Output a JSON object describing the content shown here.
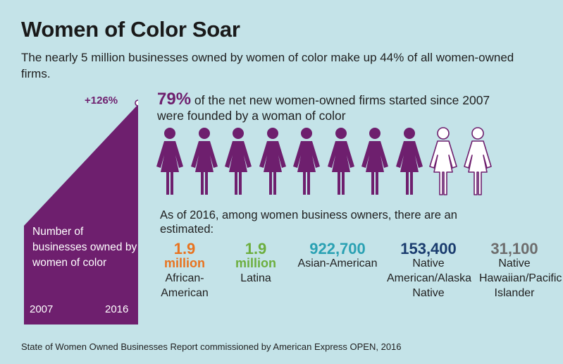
{
  "title": "Women of Color Soar",
  "subtitle": "The nearly 5 million businesses owned by women of color make up 44% of all women-owned firms.",
  "growth": {
    "label": "+126%",
    "value_percent": 126,
    "caption": "Number of businesses owned by women of color",
    "year_start": "2007",
    "year_end": "2016",
    "color": "#6e1f6e"
  },
  "headline": {
    "percent": "79%",
    "text": " of the net new women-owned firms started since 2007 were founded by a woman of color"
  },
  "pictogram": {
    "filled": 8,
    "total": 10,
    "filled_color": "#6e1f6e",
    "empty_color": "#ffffff"
  },
  "breakdown": {
    "intro": "As of 2016, among women business owners, there are an estimated:",
    "items": [
      {
        "number": "1.9",
        "unit": "million",
        "label": "African-American",
        "color": "#e8731f"
      },
      {
        "number": "1.9",
        "unit": "million",
        "label": "Latina",
        "color": "#6cae3e"
      },
      {
        "number": "922,700",
        "unit": "",
        "label": "Asian-American",
        "color": "#2aa1b3"
      },
      {
        "number": "153,400",
        "unit": "",
        "label": "Native American/Alaska Native",
        "color": "#1a3c6e"
      },
      {
        "number": "31,100",
        "unit": "",
        "label": "Native Hawaiian/Pacific Islander",
        "color": "#6d6d6d"
      }
    ]
  },
  "footnote": "State of Women Owned Businesses Report commissioned by American Express OPEN, 2016"
}
